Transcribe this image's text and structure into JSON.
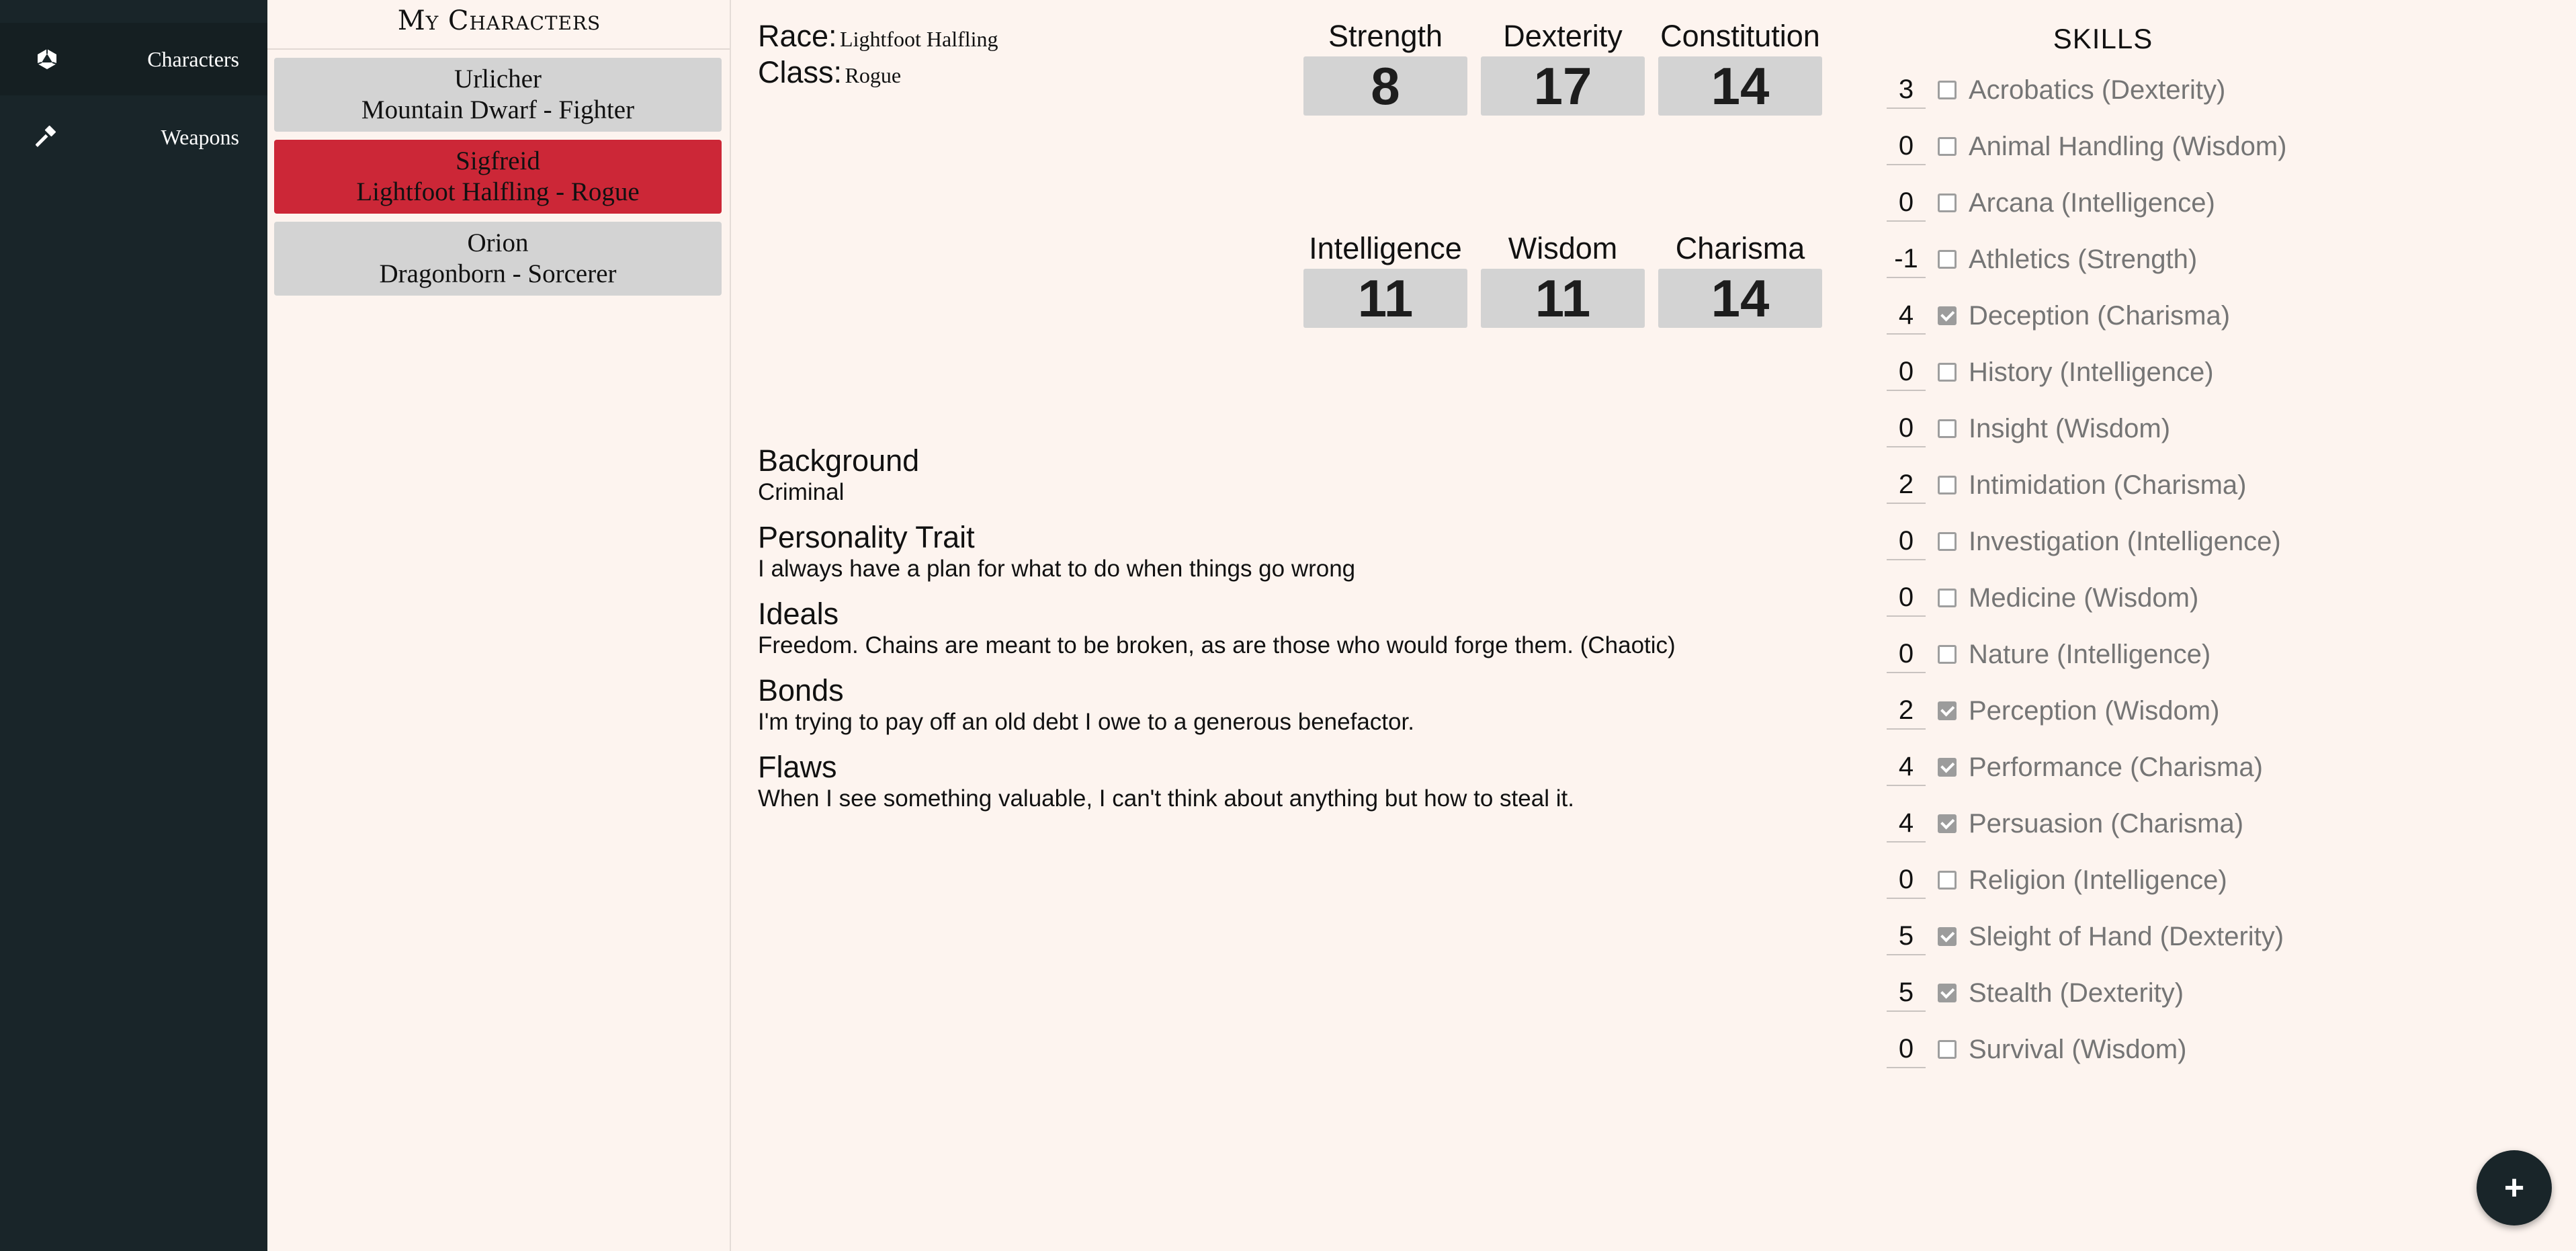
{
  "nav": {
    "items": [
      {
        "label": "Characters",
        "icon": "d20-icon"
      },
      {
        "label": "Weapons",
        "icon": "hammer-icon"
      }
    ]
  },
  "characters": {
    "title": "My Characters",
    "list": [
      {
        "name": "Urlicher",
        "subtitle": "Mountain Dwarf - Fighter"
      },
      {
        "name": "Sigfreid",
        "subtitle": "Lightfoot Halfling - Rogue",
        "selected": true
      },
      {
        "name": "Orion",
        "subtitle": "Dragonborn - Sorcerer"
      }
    ]
  },
  "sheet": {
    "race_label": "Race:",
    "race": "Lightfoot Halfling",
    "class_label": "Class:",
    "class": "Rogue",
    "stats": [
      {
        "name": "Strength",
        "value": "8"
      },
      {
        "name": "Dexterity",
        "value": "17"
      },
      {
        "name": "Constitution",
        "value": "14"
      },
      {
        "name": "Intelligence",
        "value": "11"
      },
      {
        "name": "Wisdom",
        "value": "11"
      },
      {
        "name": "Charisma",
        "value": "14"
      }
    ],
    "background_title": "Background",
    "background": "Criminal",
    "personality_title": "Personality Trait",
    "personality": "I always have a plan for what to do when things go wrong",
    "ideals_title": "Ideals",
    "ideals": "Freedom. Chains are meant to be broken, as are those who would forge them. (Chaotic)",
    "bonds_title": "Bonds",
    "bonds": "I'm trying to pay off an old debt I owe to a generous benefactor.",
    "flaws_title": "Flaws",
    "flaws": "When I see something valuable, I can't think about anything but how to steal it."
  },
  "skills": {
    "title": "SKILLS",
    "list": [
      {
        "value": "3",
        "proficient": false,
        "name": "Acrobatics (Dexterity)"
      },
      {
        "value": "0",
        "proficient": false,
        "name": "Animal Handling (Wisdom)"
      },
      {
        "value": "0",
        "proficient": false,
        "name": "Arcana (Intelligence)"
      },
      {
        "value": "-1",
        "proficient": false,
        "name": "Athletics (Strength)"
      },
      {
        "value": "4",
        "proficient": true,
        "name": "Deception (Charisma)"
      },
      {
        "value": "0",
        "proficient": false,
        "name": "History (Intelligence)"
      },
      {
        "value": "0",
        "proficient": false,
        "name": "Insight (Wisdom)"
      },
      {
        "value": "2",
        "proficient": false,
        "name": "Intimidation (Charisma)"
      },
      {
        "value": "0",
        "proficient": false,
        "name": "Investigation (Intelligence)"
      },
      {
        "value": "0",
        "proficient": false,
        "name": "Medicine (Wisdom)"
      },
      {
        "value": "0",
        "proficient": false,
        "name": "Nature (Intelligence)"
      },
      {
        "value": "2",
        "proficient": true,
        "name": "Perception (Wisdom)"
      },
      {
        "value": "4",
        "proficient": true,
        "name": "Performance (Charisma)"
      },
      {
        "value": "4",
        "proficient": true,
        "name": "Persuasion (Charisma)"
      },
      {
        "value": "0",
        "proficient": false,
        "name": "Religion (Intelligence)"
      },
      {
        "value": "5",
        "proficient": true,
        "name": "Sleight of Hand (Dexterity)"
      },
      {
        "value": "5",
        "proficient": true,
        "name": "Stealth (Dexterity)"
      },
      {
        "value": "0",
        "proficient": false,
        "name": "Survival (Wisdom)"
      }
    ]
  },
  "fab": {
    "label": "+"
  },
  "colors": {
    "nav_bg": "#192529",
    "page_bg": "#fdf4ef",
    "selected_card": "#cc2737",
    "card": "#d3d3d3"
  }
}
